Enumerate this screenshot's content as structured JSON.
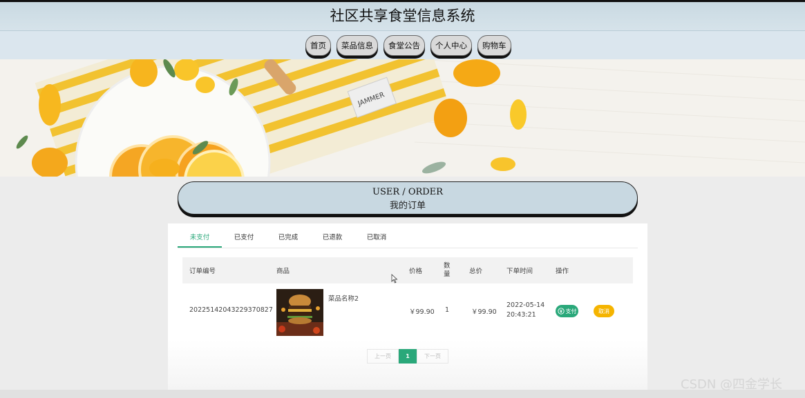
{
  "app": {
    "title": "社区共享食堂信息系统"
  },
  "nav": {
    "items": [
      {
        "label": "首页"
      },
      {
        "label": "菜品信息"
      },
      {
        "label": "食堂公告"
      },
      {
        "label": "个人中心"
      },
      {
        "label": "购物车"
      }
    ]
  },
  "banner": {
    "napkin_text": "JAMMER"
  },
  "section": {
    "title_en": "USER / ORDER",
    "title_cn": "我的订单"
  },
  "tabs": [
    {
      "label": "未支付",
      "active": true
    },
    {
      "label": "已支付"
    },
    {
      "label": "已完成"
    },
    {
      "label": "已退款"
    },
    {
      "label": "已取消"
    }
  ],
  "table": {
    "headers": {
      "order_no": "订单编号",
      "product": "商品",
      "price": "价格",
      "qty_line1": "数",
      "qty_line2": "量",
      "total": "总价",
      "time": "下单时间",
      "action": "操作"
    },
    "rows": [
      {
        "order_no": "20225142043229370827",
        "product_name": "菜品名称2",
        "price": "￥99.90",
        "qty": "1",
        "total": "￥99.90",
        "date": "2022-05-14",
        "time": "20:43:21",
        "pay_label": "支付",
        "cancel_label": "取消"
      }
    ]
  },
  "pagination": {
    "prev": "上一页",
    "current": "1",
    "next": "下一页"
  },
  "watermark": "CSDN @四金学长",
  "colors": {
    "accent": "#2aa87a",
    "warning": "#f5b400",
    "header_bg": "#c8d8e1"
  },
  "icons": {
    "pay": "yen-circle-icon"
  }
}
